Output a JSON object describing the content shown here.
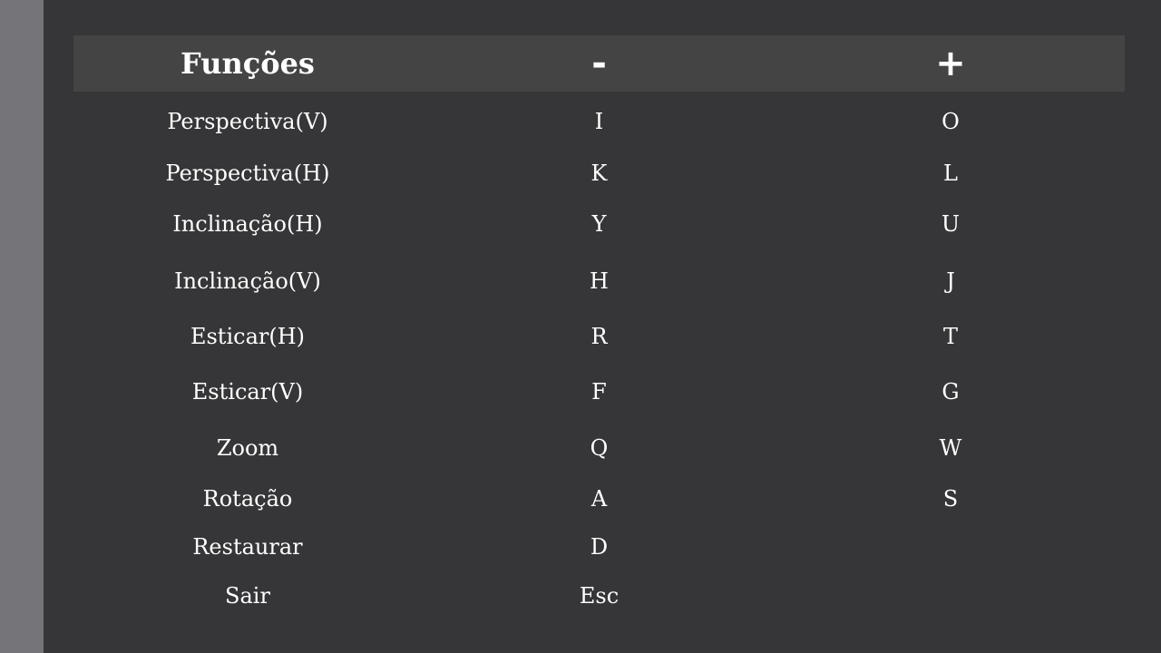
{
  "table": {
    "headers": [
      "Funções",
      "-",
      "+"
    ],
    "rows": [
      {
        "function": "Perspectiva(V)",
        "minus": "I",
        "plus": "O"
      },
      {
        "function": "Perspectiva(H)",
        "minus": "K",
        "plus": "L"
      },
      {
        "function": "Inclinação(H)",
        "minus": "Y",
        "plus": "U"
      },
      {
        "function": "Inclinação(V)",
        "minus": "H",
        "plus": "J"
      },
      {
        "function": "Esticar(H)",
        "minus": "R",
        "plus": "T"
      },
      {
        "function": "Esticar(V)",
        "minus": "F",
        "plus": "G"
      },
      {
        "function": "Zoom",
        "minus": "Q",
        "plus": "W"
      },
      {
        "function": "Rotação",
        "minus": "A",
        "plus": "S"
      },
      {
        "function": "Restaurar",
        "minus": "D",
        "plus": ""
      },
      {
        "function": "Sair",
        "minus": "Esc",
        "plus": ""
      }
    ]
  },
  "colors": {
    "background": "#363638",
    "side_bar": "#757479",
    "header_background": "#444444",
    "text": "#ffffff"
  }
}
